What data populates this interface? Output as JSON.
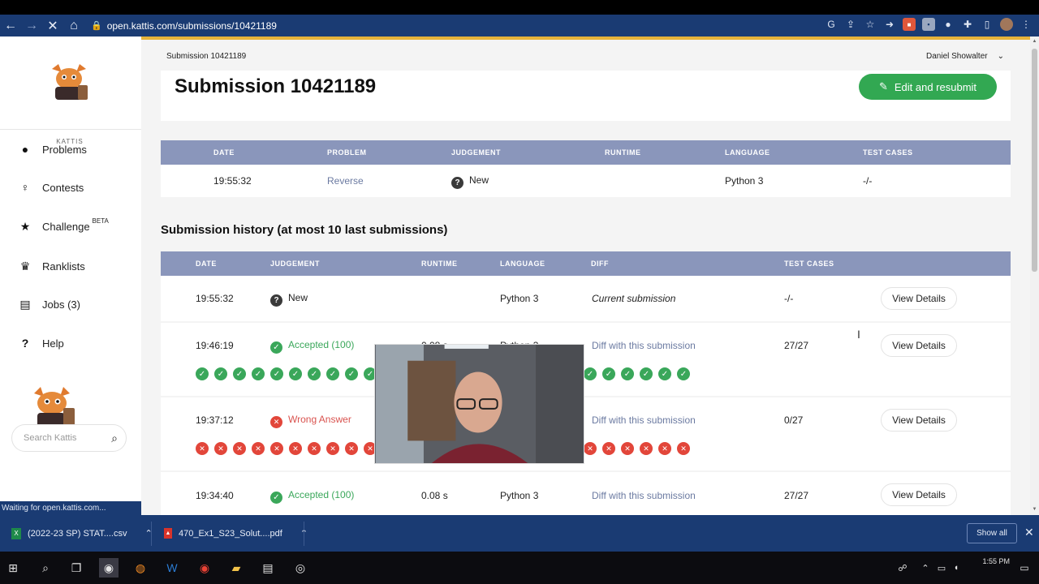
{
  "browser": {
    "url": "open.kattis.com/submissions/10421189",
    "status": "Waiting for open.kattis.com...",
    "extensions": [
      "google-icon",
      "share-icon",
      "star-icon",
      "arrow-icon",
      "ext-red-icon",
      "ext-gray-icon",
      "ext-circle-icon",
      "puzzle-icon",
      "sidepanel-icon",
      "profile-avatar",
      "menu-icon"
    ]
  },
  "sidebar": {
    "logo_text": "KATTIS",
    "items": [
      {
        "label": "Problems",
        "icon": "brain-icon"
      },
      {
        "label": "Contests",
        "icon": "contest-icon"
      },
      {
        "label": "Challenge",
        "sup": "BETA",
        "icon": "star-icon"
      },
      {
        "label": "Ranklists",
        "icon": "trophy-icon"
      },
      {
        "label": "Jobs (3)",
        "icon": "jobs-icon"
      },
      {
        "label": "Help",
        "icon": "help-icon"
      }
    ],
    "search_placeholder": "Search Kattis"
  },
  "header": {
    "breadcrumb": "Submission 10421189",
    "user": "Daniel Showalter"
  },
  "submission": {
    "title": "Submission 10421189",
    "edit_button": "Edit and resubmit",
    "columns": [
      "DATE",
      "PROBLEM",
      "JUDGEMENT",
      "RUNTIME",
      "LANGUAGE",
      "TEST CASES"
    ],
    "row": {
      "date": "19:55:32",
      "problem": "Reverse",
      "judgement": "New",
      "runtime": "",
      "language": "Python 3",
      "test_cases": "-/-"
    }
  },
  "history": {
    "title": "Submission history (at most 10 last submissions)",
    "columns": [
      "DATE",
      "JUDGEMENT",
      "RUNTIME",
      "LANGUAGE",
      "DIFF",
      "TEST CASES"
    ],
    "view_details": "View Details",
    "rows": [
      {
        "date": "19:55:32",
        "judgement": "New",
        "runtime": "",
        "language": "Python 3",
        "diff": "Current submission",
        "test_cases": "-/-"
      },
      {
        "date": "19:46:19",
        "judgement": "Accepted (100)",
        "runtime": "0.08 s",
        "language": "Python 3",
        "diff": "Diff with this submission",
        "test_cases": "27/27"
      },
      {
        "date": "19:37:12",
        "judgement": "Wrong Answer",
        "runtime": "",
        "language": "",
        "diff": "Diff with this submission",
        "test_cases": "0/27"
      },
      {
        "date": "19:34:40",
        "judgement": "Accepted (100)",
        "runtime": "0.08 s",
        "language": "Python 3",
        "diff": "Diff with this submission",
        "test_cases": "27/27"
      }
    ]
  },
  "downloads": [
    {
      "name": "(2022-23 SP) STAT....csv",
      "icon": "excel-icon"
    },
    {
      "name": "470_Ex1_S23_Solut....pdf",
      "icon": "pdf-icon"
    }
  ],
  "downloads_show_all": "Show all",
  "taskbar": {
    "time": "1:55 PM"
  },
  "colors": {
    "accent_green": "#32a852",
    "header_blue": "#8a96bb",
    "chrome_blue": "#1a3b73",
    "error_red": "#e2463a"
  }
}
